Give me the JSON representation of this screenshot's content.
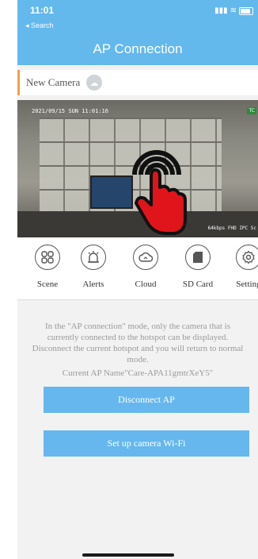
{
  "status": {
    "time": "11:01",
    "back": "◂ Search"
  },
  "header": {
    "title": "AP Connection"
  },
  "camera": {
    "name": "New Camera"
  },
  "video": {
    "timestamp": "2021/09/15  SUN 11:01:16",
    "bitrate": "64kbps FHD IPC Sc",
    "tag": "TC"
  },
  "tools": [
    {
      "label": "Scene",
      "icon": "scene-icon"
    },
    {
      "label": "Alerts",
      "icon": "alarm-icon"
    },
    {
      "label": "Cloud",
      "icon": "cloud-icon"
    },
    {
      "label": "SD Card",
      "icon": "sd-card-icon"
    },
    {
      "label": "Setting",
      "icon": "gear-icon"
    }
  ],
  "info": {
    "line1": "In the \"AP connection\" mode, only the camera that is",
    "line2": "currently connected to the hotspot can be displayed.",
    "line3": "Disconnect the current hotspot and you will return to normal",
    "line4": "mode.",
    "ap_name": "Current AP Name\"Care-APA11gmtrXeY5\""
  },
  "buttons": {
    "disconnect": "Disconnect AP",
    "setup": "Set up camera Wi-Fi"
  },
  "colors": {
    "header": "#63b8ec",
    "button": "#65b7ee",
    "accent": "#f0a04a"
  }
}
